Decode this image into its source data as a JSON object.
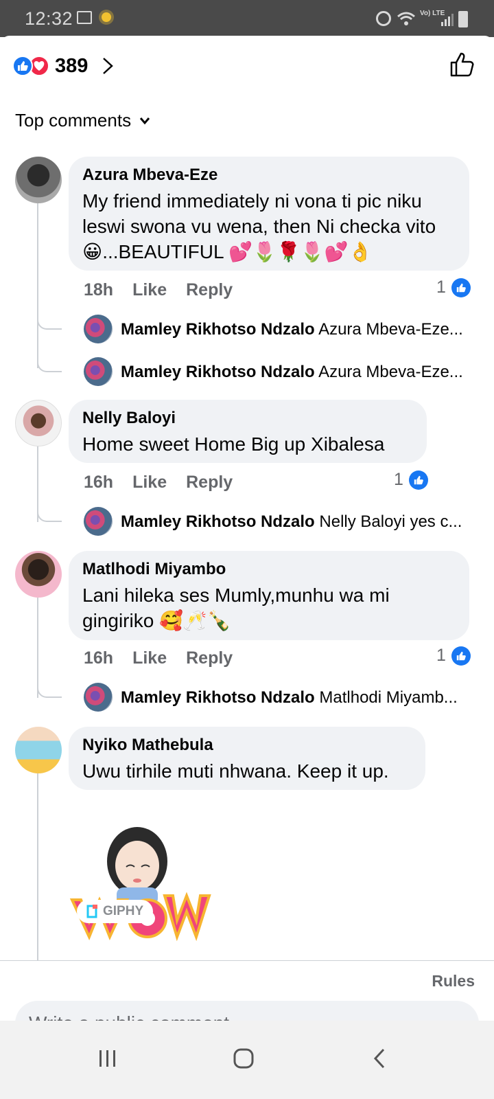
{
  "status_bar": {
    "time": "12:32",
    "icons": [
      "gallery-icon",
      "sun-icon",
      "alarm-icon",
      "wifi-icon",
      "volte-icon",
      "signal-icon",
      "battery-icon"
    ],
    "volte_label": "Vo) LTE"
  },
  "header": {
    "reaction_count": "389",
    "reactions": [
      "like",
      "love"
    ]
  },
  "sort": {
    "label": "Top comments"
  },
  "comments": [
    {
      "author": "Azura Mbeva-Eze",
      "text": "My friend immediately ni vona ti pic niku leswi swona vu wena, then Ni checka vito 😀...BEAUTIFUL  💕🌷🌹🌷💕👌",
      "time": "18h",
      "like_label": "Like",
      "reply_label": "Reply",
      "likes": "1",
      "replies": [
        {
          "author": "Mamley Rikhotso Ndzalo",
          "text": "Azura Mbeva-Eze..."
        },
        {
          "author": "Mamley Rikhotso Ndzalo",
          "text": "Azura Mbeva-Eze..."
        }
      ]
    },
    {
      "author": "Nelly Baloyi",
      "text": "Home sweet Home Big up  Xibalesa",
      "time": "16h",
      "like_label": "Like",
      "reply_label": "Reply",
      "likes": "1",
      "replies": [
        {
          "author": "Mamley Rikhotso Ndzalo",
          "text": "Nelly Baloyi yes c..."
        }
      ]
    },
    {
      "author": "Matlhodi Miyambo",
      "text": "Lani hileka ses Mumly,munhu wa mi gingiriko 🥰🥂🍾",
      "time": "16h",
      "like_label": "Like",
      "reply_label": "Reply",
      "likes": "1",
      "replies": [
        {
          "author": "Mamley Rikhotso Ndzalo",
          "text": "Matlhodi Miyamb..."
        }
      ]
    },
    {
      "author": "Nyiko Mathebula",
      "text": "Uwu tirhile muti nhwana. Keep it up.",
      "gif_badge": "GIPHY"
    }
  ],
  "composer": {
    "rules_label": "Rules",
    "placeholder": "Write a public comment…"
  },
  "navbar": {
    "icons": [
      "recents-icon",
      "home-icon",
      "back-icon"
    ]
  },
  "colors": {
    "accent": "#1877f2",
    "love": "#f02849",
    "bubble": "#f0f2f5",
    "muted": "#65676b"
  }
}
